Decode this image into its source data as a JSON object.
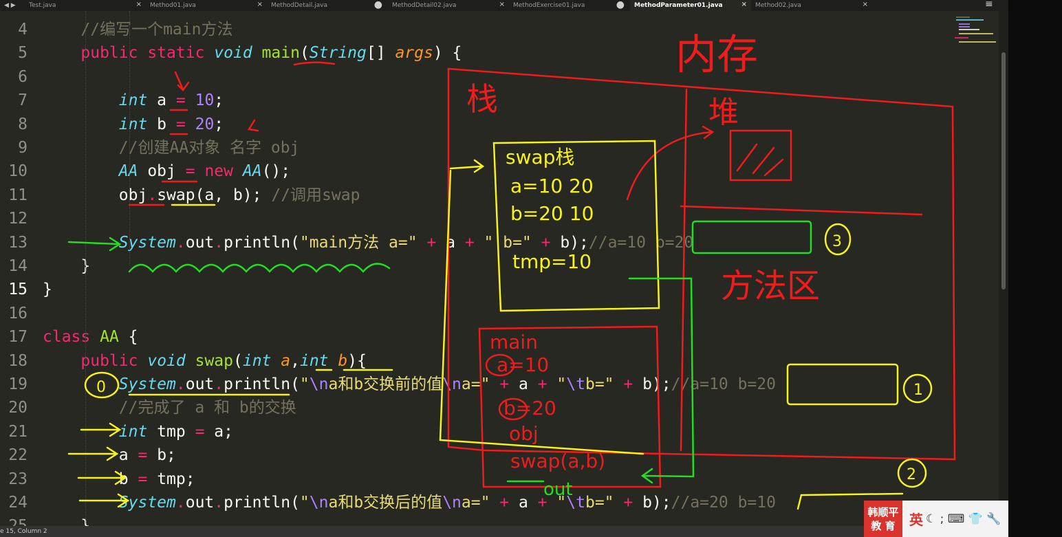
{
  "tabs": [
    {
      "label": "Test.java",
      "indicator": "×",
      "active": false
    },
    {
      "label": "Method01.java",
      "indicator": "×",
      "active": false
    },
    {
      "label": "MethodDetail.java",
      "indicator": "●",
      "active": false
    },
    {
      "label": "MethodDetail02.java",
      "indicator": "×",
      "active": false
    },
    {
      "label": "MethodExercise01.java",
      "indicator": "●",
      "active": false
    },
    {
      "label": "MethodParameter01.java",
      "indicator": "×",
      "active": true
    },
    {
      "label": "Method02.java",
      "indicator": "×",
      "active": false
    }
  ],
  "nav_arrows": "◀ ▶",
  "menu_icon": "≡",
  "status": {
    "text": "e 15, Column 2"
  },
  "code_lines": [
    {
      "n": "4",
      "html": "    <span class=\"cm\">//编写一个main方法</span>"
    },
    {
      "n": "5",
      "html": "    <span class=\"kw\">public</span> <span class=\"kw\">static</span> <span class=\"ty\">void</span> <span class=\"fn\">main</span>(<span class=\"ty\">String</span>[] <span class=\"par\">args</span>) {"
    },
    {
      "n": "6",
      "html": ""
    },
    {
      "n": "7",
      "html": "        <span class=\"ty\">int</span> a <span class=\"op\">=</span> <span class=\"num\">10</span>;"
    },
    {
      "n": "8",
      "html": "        <span class=\"ty\">int</span> b <span class=\"op\">=</span> <span class=\"num\">20</span>;"
    },
    {
      "n": "9",
      "html": "        <span class=\"cm\">//创建AA对象 名字 obj</span>"
    },
    {
      "n": "10",
      "html": "        <span class=\"ty\">AA</span> obj <span class=\"op\">=</span> <span class=\"kw\">new</span> <span class=\"ty\">AA</span>();"
    },
    {
      "n": "11",
      "html": "        obj<span class=\"op\">.</span>swap(a, b); <span class=\"cm\">//调用swap</span>"
    },
    {
      "n": "12",
      "html": ""
    },
    {
      "n": "13",
      "html": "        <span class=\"ty\">System</span><span class=\"op\">.</span>out<span class=\"op\">.</span>println(<span class=\"str\">\"main方法 a=\"</span> <span class=\"op\">+</span> a <span class=\"op\">+</span> <span class=\"str\">\" b=\"</span> <span class=\"op\">+</span> b);<span class=\"cm\">//a=10 b=20</span>"
    },
    {
      "n": "14",
      "html": "    }"
    },
    {
      "n": "15",
      "html": "}"
    },
    {
      "n": "16",
      "html": ""
    },
    {
      "n": "17",
      "html": "<span class=\"kw\">class</span> <span class=\"fn\">AA</span> {"
    },
    {
      "n": "18",
      "html": "    <span class=\"kw\">public</span> <span class=\"ty\">void</span> <span class=\"fn\">swap</span>(<span class=\"ty\">int</span> <span class=\"par\">a</span>,<span class=\"ty\">int</span> <span class=\"par\">b</span>){"
    },
    {
      "n": "19",
      "html": "        <span class=\"ty\">System</span><span class=\"op\">.</span>out<span class=\"op\">.</span>println(<span class=\"str\">\"<span class=\"esc\">\\n</span>a和b交换前的值<span class=\"esc\">\\n</span>a=\"</span> <span class=\"op\">+</span> a <span class=\"op\">+</span> <span class=\"str\">\"<span class=\"esc\">\\t</span>b=\"</span> <span class=\"op\">+</span> b);<span class=\"cm\">//a=10 b=20</span>"
    },
    {
      "n": "20",
      "html": "        <span class=\"cm\">//完成了 a 和 b的交换</span>"
    },
    {
      "n": "21",
      "html": "        <span class=\"ty\">int</span> tmp <span class=\"op\">=</span> a;"
    },
    {
      "n": "22",
      "html": "        a <span class=\"op\">=</span> b;"
    },
    {
      "n": "23",
      "html": "        b <span class=\"op\">=</span> tmp;"
    },
    {
      "n": "24",
      "html": "        <span class=\"ty\">System</span><span class=\"op\">.</span>out<span class=\"op\">.</span>println(<span class=\"str\">\"<span class=\"esc\">\\n</span>a和b交换后的值<span class=\"esc\">\\n</span>a=\"</span> <span class=\"op\">+</span> a <span class=\"op\">+</span> <span class=\"str\">\"<span class=\"esc\">\\t</span>b=\"</span> <span class=\"op\">+</span> b);<span class=\"cm\">//a=20 b=10</span>"
    },
    {
      "n": "25",
      "html": "    }"
    }
  ],
  "current_line": "15",
  "handwriting": {
    "memory": "内存",
    "stack": "栈",
    "heap": "堆",
    "method_area": "方法区",
    "swap_frame": [
      "swap栈",
      "a=10 20",
      "b=20 10",
      "tmp=10"
    ],
    "main_frame": [
      "main",
      "a=10",
      "b=20",
      "obj"
    ],
    "call": "swap(a,b)",
    "out": "out",
    "marks": [
      "0",
      "1",
      "2",
      "3"
    ]
  },
  "ime": {
    "logo_top": "韩顺平",
    "logo_bottom": "教 育",
    "lang": "英",
    "icons": "☾ ; ⌨ 👕 🔧"
  }
}
